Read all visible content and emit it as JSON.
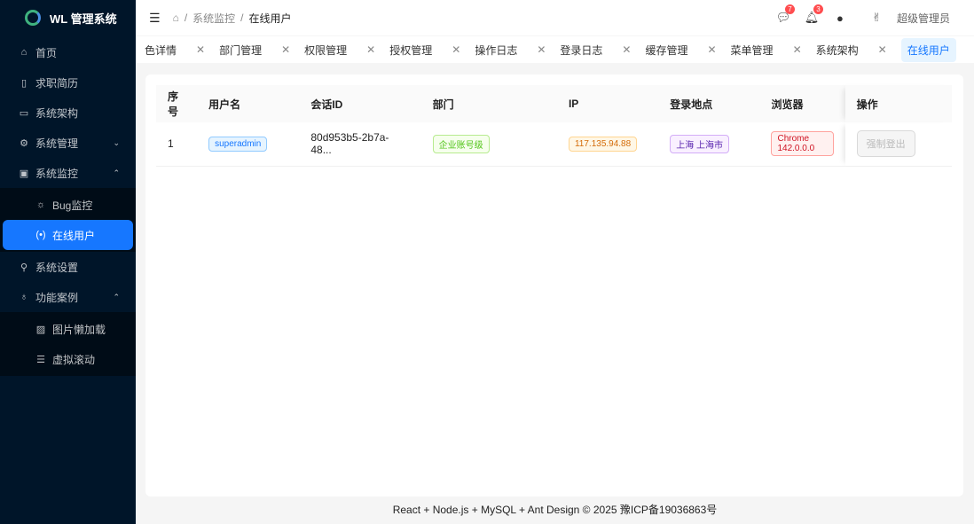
{
  "app": {
    "title": "WL 管理系统"
  },
  "sidebar": {
    "items": [
      {
        "label": "首页",
        "icon": "home-icon",
        "glyph": "⌂"
      },
      {
        "label": "求职简历",
        "icon": "document-icon",
        "glyph": "▯"
      },
      {
        "label": "系统架构",
        "icon": "laptop-icon",
        "glyph": "▭"
      },
      {
        "label": "系统管理",
        "icon": "gear-icon",
        "glyph": "⚙",
        "arrow": "⌄"
      },
      {
        "label": "系统监控",
        "icon": "monitor-icon",
        "glyph": "▣",
        "arrow": "⌃"
      },
      {
        "label": "Bug监控",
        "icon": "bug-icon",
        "glyph": "☼"
      },
      {
        "label": "在线用户",
        "icon": "wifi-icon",
        "glyph": "(•)"
      },
      {
        "label": "系统设置",
        "icon": "wrench-icon",
        "glyph": "⚲"
      },
      {
        "label": "功能案例",
        "icon": "bulb-icon",
        "glyph": "♁",
        "arrow": "⌃"
      },
      {
        "label": "图片懒加载",
        "icon": "image-icon",
        "glyph": "▨"
      },
      {
        "label": "虚拟滚动",
        "icon": "list-icon",
        "glyph": "☰"
      }
    ]
  },
  "header": {
    "breadcrumb": [
      "系统监控",
      "在线用户"
    ],
    "message_count": "7",
    "notification_count": "3",
    "username": "超级管理员"
  },
  "tabs": [
    "色详情",
    "部门管理",
    "权限管理",
    "授权管理",
    "操作日志",
    "登录日志",
    "缓存管理",
    "菜单管理",
    "系统架构",
    "在线用户"
  ],
  "table": {
    "headers": [
      "序号",
      "用户名",
      "会话ID",
      "部门",
      "IP",
      "登录地点",
      "浏览器",
      "操作"
    ],
    "rows": [
      {
        "index": "1",
        "username": "superadmin",
        "session": "80d953b5-2b7a-48...",
        "dept": "企业账号级",
        "ip": "117.135.94.88",
        "location": "上海 上海市",
        "browser": "Chrome 142.0.0.0",
        "action": "强制登出"
      }
    ]
  },
  "footer": "React + Node.js + MySQL + Ant Design © 2025 豫ICP备19036863号"
}
